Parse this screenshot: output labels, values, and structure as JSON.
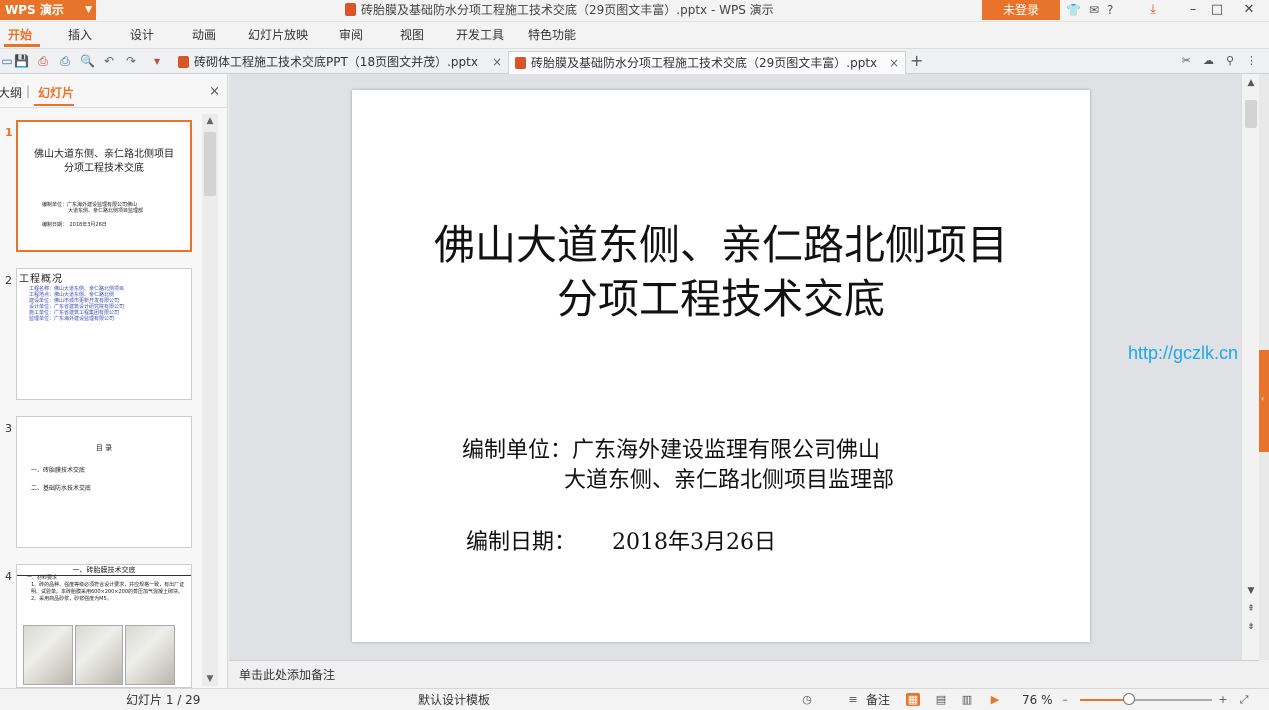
{
  "app": {
    "name": "WPS 演示",
    "window_title": "砖胎膜及基础防水分项工程施工技术交底（29页图文丰富）.pptx - WPS 演示",
    "login_label": "未登录",
    "accent_color": "#e8742b"
  },
  "menu": [
    "开始",
    "插入",
    "设计",
    "动画",
    "幻灯片放映",
    "审阅",
    "视图",
    "开发工具",
    "特色功能"
  ],
  "tabs": [
    {
      "label": "砖砌体工程施工技术交底PPT（18页图文并茂）.pptx",
      "close": "×"
    },
    {
      "label": "砖胎膜及基础防水分项工程施工技术交底（29页图文丰富）.pptx",
      "close": "×"
    }
  ],
  "tab_add": "+",
  "side": {
    "tab_outline": "大纲",
    "tab_slides": "幻灯片",
    "close": "×",
    "thumbs": [
      {
        "num": "1",
        "title": "佛山大道东侧、亲仁路北侧项目分项工程技术交底",
        "meta1": "编制单位：广东海外建设监理有限公司佛山",
        "meta1b": "大道东侧、亲仁路北侧项目监理部",
        "meta2": "编制日期：　2018年3月26日"
      },
      {
        "num": "2",
        "title": "工程概况",
        "lines": [
          "工程名称：佛山大道东侧、亲仁路北侧项目",
          "工程地点：佛山大道东侧、亲仁路北侧",
          "建设单位：佛山市城市更新开发有限公司",
          "设计单位：广东省建筑设计研究院有限公司",
          "施工单位：广东省建筑工程集团有限公司",
          "监理单位：广东海外建设监理有限公司"
        ]
      },
      {
        "num": "3",
        "title": "目 录",
        "items": [
          "一、砖胎膜技术交底",
          "二、基础防水技术交底"
        ]
      },
      {
        "num": "4",
        "title": "一、砖胎膜技术交底",
        "lines": [
          "一、材料要求",
          "1、砖的品种、强度等级必须符合设计要求，并应规格一致，有出厂证明、试验单。本砖胎膜采用600×200×200的蒸压加气混凝土砌块。",
          "2、采用商品砂浆，砂浆强度为M5。"
        ]
      }
    ]
  },
  "slide": {
    "title_line1": "佛山大道东侧、亲仁路北侧项目",
    "title_line2": "分项工程技术交底",
    "unit_label": "编制单位：广东海外建设监理有限公司佛山",
    "unit_line2": "大道东侧、亲仁路北侧项目监理部",
    "date_label": "编制日期：",
    "date_value": "2018年3月26日"
  },
  "watermark": "http://gczlk.cn",
  "notes_placeholder": "单击此处添加备注",
  "status": {
    "slide_counter": "幻灯片 1 / 29",
    "template": "默认设计模板",
    "notes_label": "备注",
    "zoom": "76 %",
    "zoom_fraction": 0.37
  }
}
